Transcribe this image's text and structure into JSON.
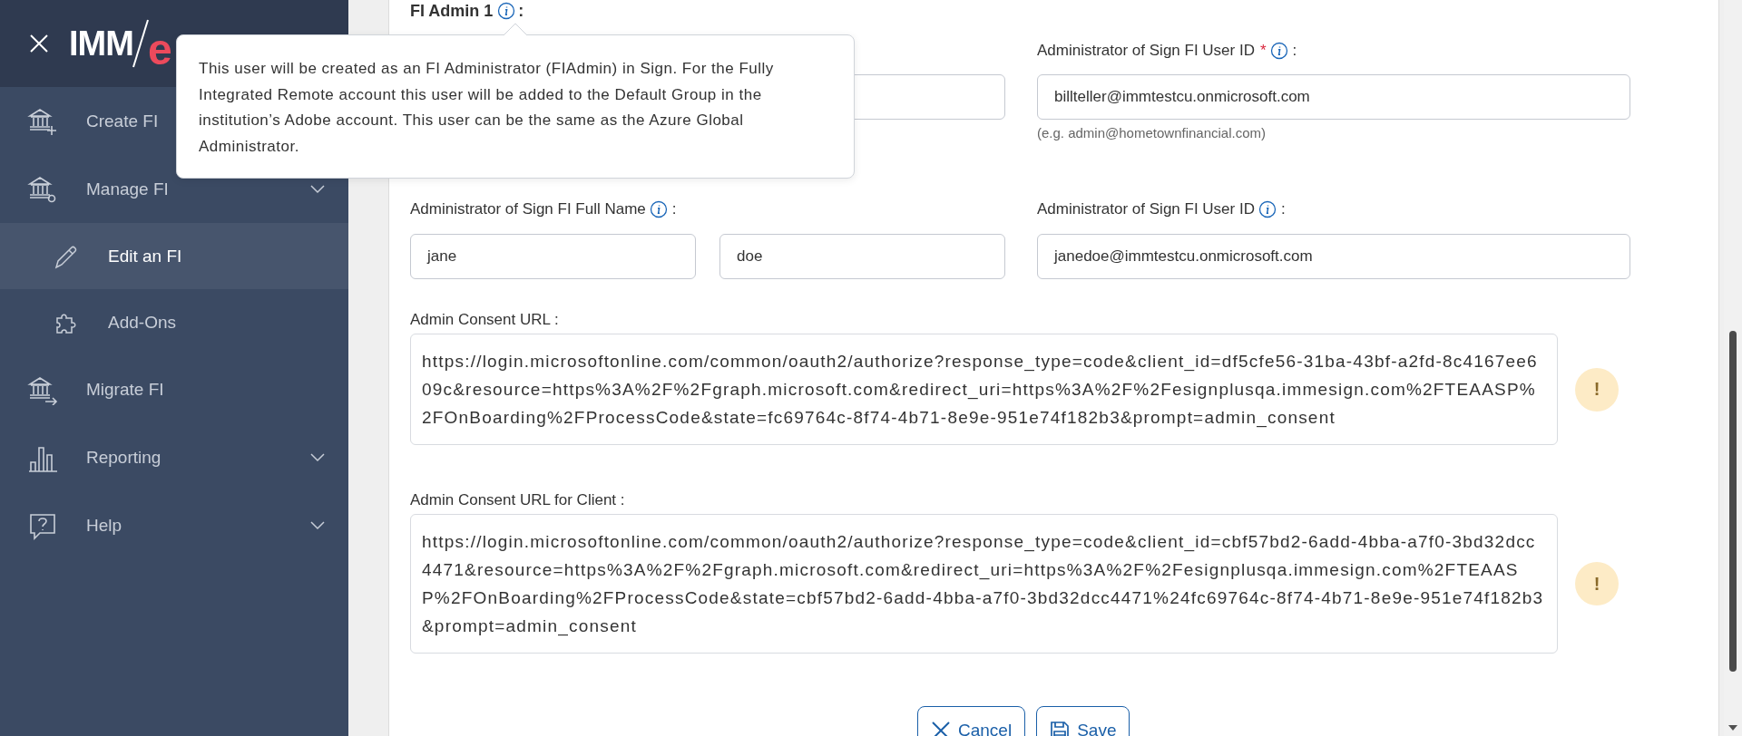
{
  "sidebar": {
    "logo": {
      "part_1": "IMM",
      "part_2": "e"
    },
    "items": [
      {
        "label": "Create FI",
        "kind": "create",
        "selected": false
      },
      {
        "label": "Manage FI",
        "kind": "manage",
        "expandable": true,
        "expanded": true,
        "selected": false,
        "children": [
          {
            "label": "Edit an FI",
            "kind": "edit",
            "selected": true
          },
          {
            "label": "Add-Ons",
            "kind": "addons",
            "selected": false
          }
        ]
      },
      {
        "label": "Migrate FI",
        "kind": "migrate",
        "selected": false
      },
      {
        "label": "Reporting",
        "kind": "reporting",
        "expandable": true,
        "selected": false
      },
      {
        "label": "Help",
        "kind": "help",
        "expandable": true,
        "selected": false
      }
    ]
  },
  "form": {
    "section_title": "FI Admin 1",
    "section_suffix": ":",
    "rows": [
      {
        "name_fields": [
          {
            "kind": "covered"
          },
          {
            "kind": "empty"
          }
        ],
        "id_label": {
          "text": "Administrator of Sign FI User ID",
          "required_mark": "*",
          "suffix": ":"
        },
        "id_field": {
          "value": "billteller@immtestcu.onmicrosoft.com"
        },
        "id_hint": "(e.g. admin@hometownfinancial.com)"
      },
      {
        "name_label": {
          "text": "Administrator of Sign FI Full Name",
          "suffix": ":"
        },
        "name_fields": [
          {
            "kind": "filled",
            "value": "jane"
          },
          {
            "kind": "filled",
            "value": "doe"
          }
        ],
        "id_label": {
          "text": "Administrator of Sign FI User ID",
          "suffix": ":"
        },
        "id_field": {
          "value": "janedoe@immtestcu.onmicrosoft.com"
        }
      }
    ],
    "urls": [
      {
        "label": "Admin Consent URL :",
        "value": "https://login.microsoftonline.com/common/oauth2/authorize?response_type=code&client_id=df5cfe56-31ba-43bf-a2fd-8c4167ee609c&resource=https%3A%2F%2Fgraph.microsoft.com&redirect_uri=https%3A%2F%2Fesignplusqa.immesign.com%2FTEAASP%2FOnBoarding%2FProcessCode&state=fc69764c-8f74-4b71-8e9e-951e74f182b3&prompt=admin_consent",
        "warning_mark": "!"
      },
      {
        "label": "Admin Consent URL for Client :",
        "value": "https://login.microsoftonline.com/common/oauth2/authorize?response_type=code&client_id=cbf57bd2-6add-4bba-a7f0-3bd32dcc4471&resource=https%3A%2F%2Fgraph.microsoft.com&redirect_uri=https%3A%2F%2Fesignplusqa.immesign.com%2FTEAASP%2FOnBoarding%2FProcessCode&state=cbf57bd2-6add-4bba-a7f0-3bd32dcc4471%24fc69764c-8f74-4b71-8e9e-951e74f182b3&prompt=admin_consent",
        "warning_mark": "!"
      }
    ],
    "buttons": [
      {
        "label": "Cancel",
        "kind": "cancel"
      },
      {
        "label": "Save",
        "kind": "save"
      }
    ]
  },
  "tooltip": {
    "text": "This user will be created as an FI Administrator (FIAdmin) in Sign. For the Fully Integrated Remote account this user will be added to the Default Group in the institution’s Adobe account. This user can be the same as the Azure Global Administrator."
  }
}
